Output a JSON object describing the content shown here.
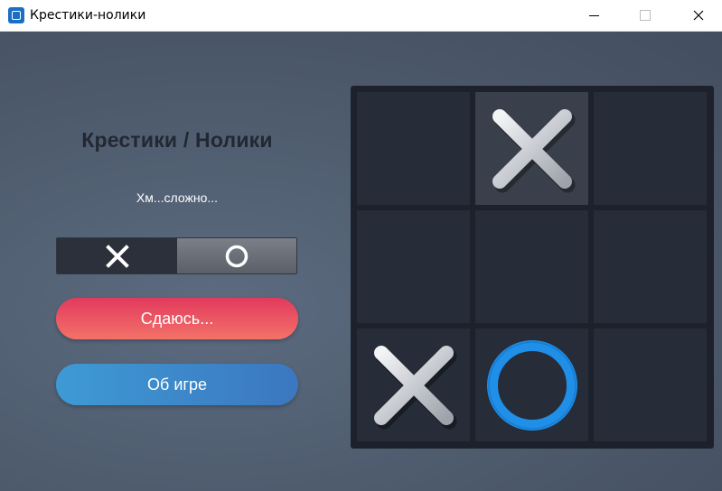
{
  "window": {
    "title": "Крестики-нолики"
  },
  "sidebar": {
    "heading": "Крестики / Нолики",
    "status": "Хм...сложно...",
    "symbol_toggle": {
      "options": [
        "X",
        "O"
      ],
      "selected": "X"
    },
    "buttons": {
      "surrender": "Сдаюсь...",
      "about": "Об игре"
    }
  },
  "board": {
    "cells": [
      "",
      "X",
      "",
      "",
      "",
      "",
      "X",
      "O",
      ""
    ],
    "highlighted_cell": 1
  },
  "colors": {
    "accent_blue": "#1f8fe8",
    "surrender_gradient": [
      "#e23a5e",
      "#f37268"
    ],
    "about_gradient": [
      "#3e9ad4",
      "#3b77c0"
    ]
  }
}
